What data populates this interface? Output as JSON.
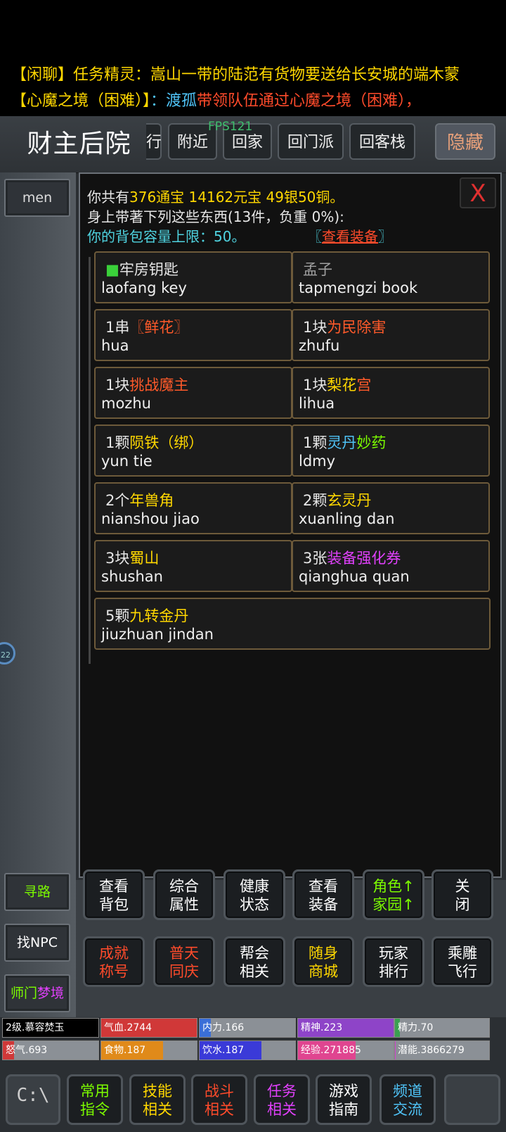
{
  "chat": [
    {
      "tag": "【闲聊】",
      "tag_color": "#ffd700",
      "text": "任务精灵：嵩山一带的陆范有货物要送给长安城的端木蒙",
      "text_color": "#ffd700"
    },
    {
      "tag": "【心魔之境（困难）】",
      "tag_color": "#ffd700",
      "text_a": "：渡孤",
      "text_a_color": "#4fc3f7",
      "text_b": "带领队伍通过心魔之境（困难），",
      "text_b_color": "#ff4b2b"
    }
  ],
  "header": {
    "location": "财主后院",
    "fps": "FPS121",
    "buttons": [
      "行",
      "附近",
      "回家",
      "回门派",
      "回客栈"
    ],
    "hide": "隐藏"
  },
  "left": {
    "men": "men",
    "xunlu": "寻路",
    "find_npc": "找NPC",
    "shimen_a": "师门",
    "shimen_b": "梦境",
    "circle": "22"
  },
  "panel": {
    "close": "X",
    "line1_pre": "你共有",
    "line1_money": "376通宝 14162元宝 49银50铜。",
    "line2": "身上带著下列这些东西(13件，负重 0%):",
    "line3": "你的背包容量上限：50。",
    "view_pre": "〖",
    "view_link": "查看装备",
    "view_post": "〗"
  },
  "items": [
    {
      "prefix": "",
      "marker": "■",
      "name": "牢房钥匙",
      "name_color": "#e6e6e6",
      "en": "laofang key"
    },
    {
      "prefix": "",
      "marker": "",
      "name": "孟子",
      "name_color": "#a0a0a0",
      "en": "tapmengzi book"
    },
    {
      "prefix": "1串",
      "marker": "",
      "name": "〖鲜花〗",
      "name_color": "#ff5a2a",
      "en": "hua"
    },
    {
      "prefix": "1块",
      "marker": "",
      "name": "为民除害",
      "name_color": "#ff5a2a",
      "en": "zhufu"
    },
    {
      "prefix": "1块",
      "marker": "",
      "name": "挑战魔主",
      "name_color": "#ff5a2a",
      "en": "mozhu"
    },
    {
      "prefix": "1块",
      "marker": "",
      "name": "梨花",
      "name_color": "#ffd700",
      "name2": "宫",
      "name2_color": "#ff5a2a",
      "en": "lihua"
    },
    {
      "prefix": "1颗",
      "marker": "",
      "name": "陨铁（绑）",
      "name_color": "#ffd700",
      "en": "yun tie"
    },
    {
      "prefix": "1颗",
      "marker": "",
      "name": "灵丹",
      "name_color": "#4fc3f7",
      "name2": "妙药",
      "name2_color": "#7cfc00",
      "en": "ldmy"
    },
    {
      "prefix": "2个",
      "marker": "",
      "name": "年兽角",
      "name_color": "#ffd700",
      "en": "nianshou jiao"
    },
    {
      "prefix": "2颗",
      "marker": "",
      "name": "玄灵丹",
      "name_color": "#ffd700",
      "en": "xuanling dan"
    },
    {
      "prefix": "3块",
      "marker": "",
      "name": "蜀山",
      "name_color": "#ffd700",
      "en": "shushan"
    },
    {
      "prefix": "3张",
      "marker": "",
      "name": "装备强化券",
      "name_color": "#e040fb",
      "en": "qianghua quan"
    },
    {
      "prefix": "5颗",
      "marker": "",
      "name": "九转金丹",
      "name_color": "#ffd700",
      "en": "jiuzhuan jindan"
    }
  ],
  "commands": [
    {
      "l1": "查看",
      "l2": "背包",
      "color": "#ffffff"
    },
    {
      "l1": "综合",
      "l2": "属性",
      "color": "#ffffff"
    },
    {
      "l1": "健康",
      "l2": "状态",
      "color": "#ffffff"
    },
    {
      "l1": "查看",
      "l2": "装备",
      "color": "#ffffff"
    },
    {
      "l1": "角色↑",
      "l2": "家园↑",
      "color": "#7cfc00"
    },
    {
      "l1": "关",
      "l2": "闭",
      "color": "#ffffff"
    },
    {
      "l1": "成就",
      "l2": "称号",
      "color": "#ff4b2b"
    },
    {
      "l1": "普天",
      "l2": "同庆",
      "color": "#ff4b2b"
    },
    {
      "l1": "帮会",
      "l2": "相关",
      "color": "#ffffff"
    },
    {
      "l1": "随身",
      "l2": "商城",
      "color": "#ffd700"
    },
    {
      "l1": "玩家",
      "l2": "排行",
      "color": "#ffffff"
    },
    {
      "l1": "乘雕",
      "l2": "飞行",
      "color": "#ffffff"
    }
  ],
  "stats": [
    {
      "label": "2级.慕容焚玉",
      "fill": 0,
      "color": "#000000"
    },
    {
      "label": "气血.2744",
      "fill": 1.0,
      "color": "#d03838"
    },
    {
      "label": "内力.166",
      "fill": 0.12,
      "color": "#3a6fd8"
    },
    {
      "label": "精神.223",
      "fill": 1.0,
      "color": "#8e44c8"
    },
    {
      "label": "精力.70",
      "fill": 0.05,
      "color": "#3aa050"
    },
    {
      "label": "怒气.693",
      "fill": 0.12,
      "color": "#d03838"
    },
    {
      "label": "食物.187",
      "fill": 0.65,
      "color": "#e08a1a"
    },
    {
      "label": "饮水.187",
      "fill": 0.65,
      "color": "#3a3ad8"
    },
    {
      "label": "经验.271885",
      "fill": 0.6,
      "color": "#e04590"
    },
    {
      "label": "潜能.3866279",
      "fill": 0.01,
      "color": "#d040d0"
    }
  ],
  "bottom": [
    {
      "l1": "常用",
      "l2": "指令",
      "color": "#7cfc00"
    },
    {
      "l1": "技能",
      "l2": "相关",
      "color": "#ffd700"
    },
    {
      "l1": "战斗",
      "l2": "相关",
      "color": "#ff4b2b"
    },
    {
      "l1": "任务",
      "l2": "相关",
      "color": "#e040fb"
    },
    {
      "l1": "游戏",
      "l2": "指南",
      "color": "#ffffff"
    },
    {
      "l1": "频道",
      "l2": "交流",
      "color": "#4fc3f7"
    }
  ],
  "console_label": "C:\\"
}
